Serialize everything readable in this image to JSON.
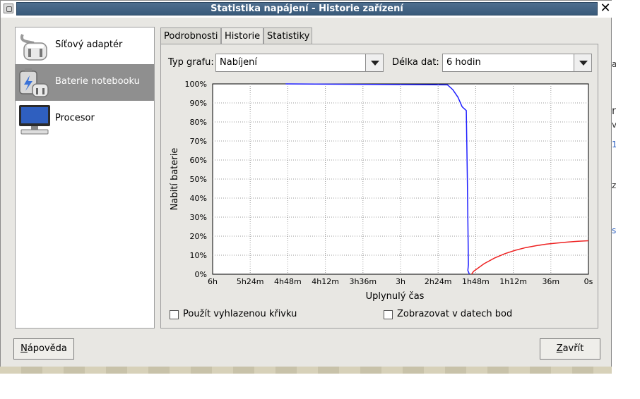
{
  "window": {
    "title": "Statistika napájení - Historie zařízení"
  },
  "sidebar": {
    "items": [
      {
        "label": "Síťový adaptér",
        "icon": "ac-adapter-icon",
        "selected": false
      },
      {
        "label": "Baterie notebooku",
        "icon": "laptop-battery-icon",
        "selected": true
      },
      {
        "label": "Procesor",
        "icon": "computer-icon",
        "selected": false
      }
    ]
  },
  "tabs": [
    {
      "label": "Podrobnosti",
      "active": false
    },
    {
      "label": "Historie",
      "active": true
    },
    {
      "label": "Statistiky",
      "active": false
    }
  ],
  "controls": {
    "graph_type_label": "Typ grafu:",
    "graph_type_value": "Nabíjení",
    "data_length_label": "Délka dat:",
    "data_length_value": "6 hodin",
    "smooth_label": "Použít vyhlazenou křivku",
    "points_label": "Zobrazovat v datech bod"
  },
  "buttons": {
    "help_mnemonic": "N",
    "help_rest": "ápověda",
    "close_mnemonic": "Z",
    "close_rest": "avřít"
  },
  "right_fragments": [
    "ar",
    "n",
    "v",
    "1",
    "z",
    "s"
  ],
  "chart_data": {
    "type": "line",
    "xlabel": "Uplynulý čas",
    "ylabel": "Nabití baterie",
    "x_ticks": [
      "6h",
      "5h24m",
      "4h48m",
      "4h12m",
      "3h36m",
      "3h",
      "2h24m",
      "1h48m",
      "1h12m",
      "36m",
      "0s"
    ],
    "y_ticks": [
      "0%",
      "10%",
      "20%",
      "30%",
      "40%",
      "50%",
      "60%",
      "70%",
      "80%",
      "90%",
      "100%"
    ],
    "xlim_minutes_ago": [
      360,
      0
    ],
    "ylim": [
      0,
      100
    ],
    "grid": true,
    "series": [
      {
        "color": "#2020ff",
        "x": [
          290,
          135,
          130,
          125,
          121,
          117,
          116,
          115,
          115.5,
          114
        ],
        "y": [
          100,
          99.5,
          97,
          93,
          88,
          86,
          50,
          5,
          2,
          0
        ]
      },
      {
        "color": "#ee2222",
        "x": [
          112,
          110,
          100,
          90,
          80,
          70,
          60,
          50,
          40,
          30,
          20,
          10,
          0
        ],
        "y": [
          0,
          1.5,
          5.5,
          8.5,
          10.8,
          12.6,
          14,
          15,
          15.8,
          16.4,
          16.9,
          17.3,
          17.6
        ]
      }
    ]
  }
}
